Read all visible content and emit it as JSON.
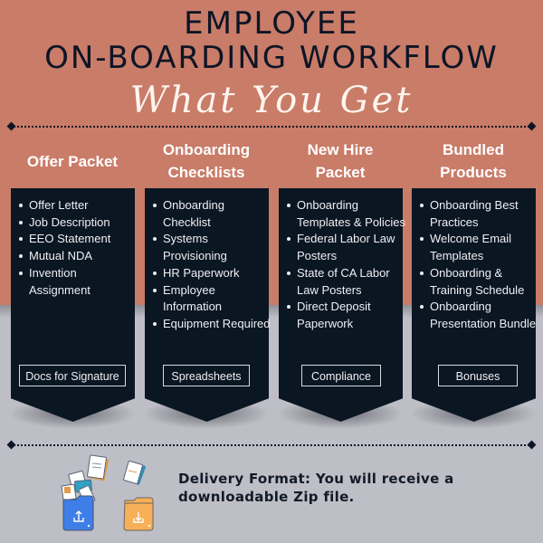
{
  "header": {
    "title_line1": "EMPLOYEE",
    "title_line2": "ON-BOARDING WORKFLOW",
    "subtitle_script": "What You Get"
  },
  "colors": {
    "top_background": "#c97c68",
    "bottom_background": "#bebec6",
    "card_background": "#0b1623",
    "title_color": "#0d1526",
    "script_color": "#fff5ee"
  },
  "columns": [
    {
      "heading": "Offer Packet",
      "items": [
        "Offer Letter",
        "Job Description",
        "EEO Statement",
        "Mutual NDA",
        "Invention Assignment"
      ],
      "tag": "Docs for Signature"
    },
    {
      "heading": "Onboarding Checklists",
      "items": [
        "Onboarding Checklist",
        "Systems Provisioning",
        "HR Paperwork",
        "Employee Information",
        "Equipment Required"
      ],
      "tag": "Spreadsheets"
    },
    {
      "heading": "New Hire Packet",
      "items": [
        "Onboarding Templates & Policies",
        "Federal Labor Law Posters",
        "State of CA Labor Law Posters",
        "Direct Deposit Paperwork"
      ],
      "tag": "Compliance"
    },
    {
      "heading": "Bundled Products",
      "items": [
        "Onboarding Best Practices",
        "Welcome Email Templates",
        "Onboarding & Training Schedule",
        "Onboarding Presentation Bundle"
      ],
      "tag": "Bonuses"
    }
  ],
  "footer": {
    "delivery_line1": "Delivery Format: You will receive a",
    "delivery_line2": "downloadable Zip file.",
    "illustration": "folders-upload-download-icon"
  }
}
